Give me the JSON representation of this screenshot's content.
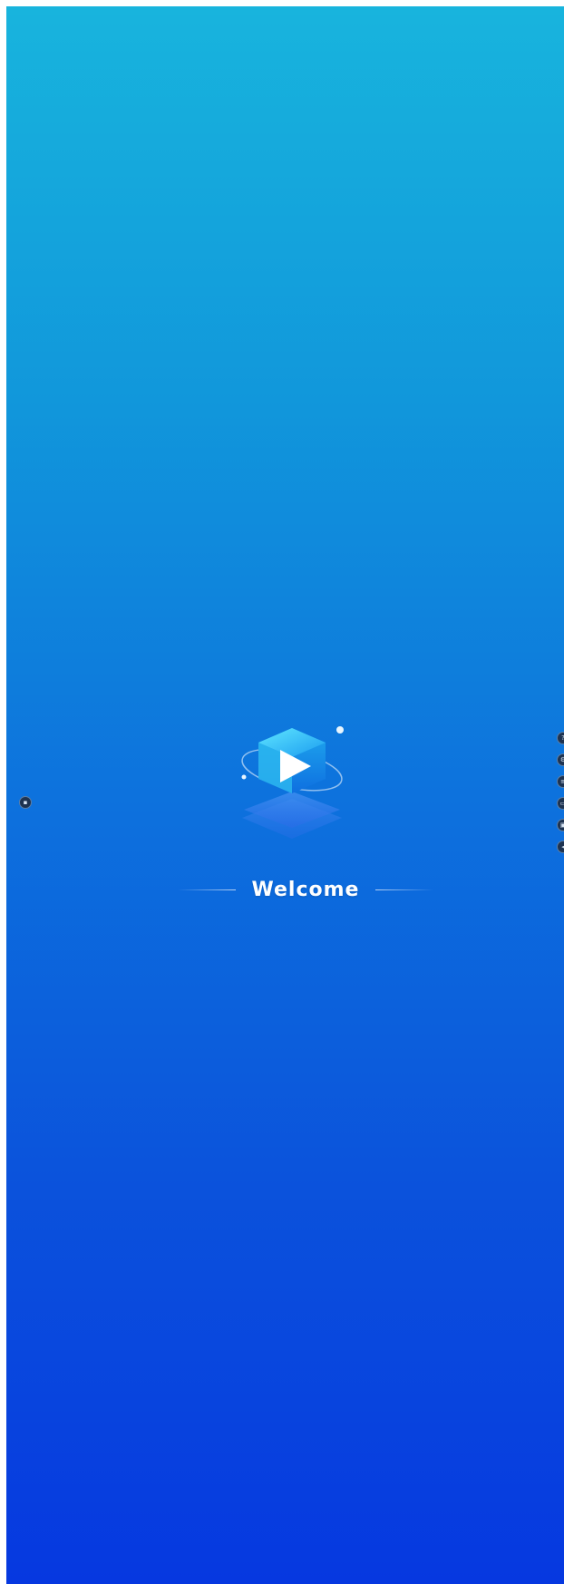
{
  "screen": {
    "welcome_label": "Welcome"
  },
  "icons": {
    "logo": "play-cube-logo-icon",
    "left_handle": "side-handle-icon",
    "right_toolbar": [
      "help-icon",
      "settings-icon",
      "layout-icon",
      "window-icon",
      "screen-icon",
      "back-icon"
    ]
  },
  "colors": {
    "gradient_top": "#18b4dd",
    "gradient_bottom": "#0638e0"
  }
}
